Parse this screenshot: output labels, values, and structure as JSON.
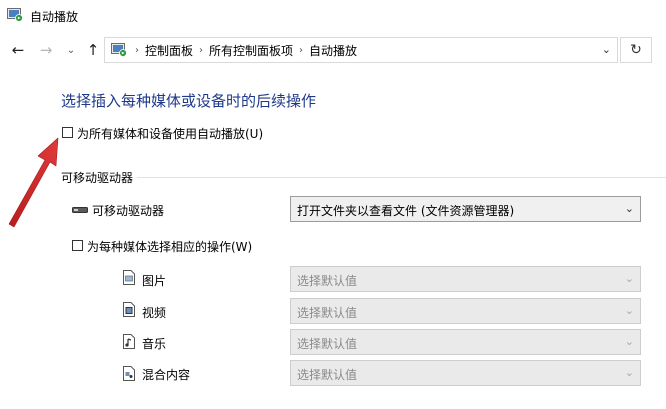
{
  "window": {
    "title": "自动播放"
  },
  "nav": {
    "back_icon": "back-arrow-icon",
    "forward_icon": "forward-arrow-icon",
    "recent_icon": "chevron-down-icon",
    "up_icon": "up-arrow-icon",
    "breadcrumb": [
      "控制面板",
      "所有控制面板项",
      "自动播放"
    ],
    "refresh_icon": "refresh-icon"
  },
  "main": {
    "heading": "选择插入每种媒体或设备时的后续操作",
    "use_autoplay_all": {
      "label": "为所有媒体和设备使用自动播放(U)",
      "checked": false
    },
    "removable_section": {
      "title": "可移动驱动器",
      "drive": {
        "label": "可移动驱动器",
        "value": "打开文件夹以查看文件 (文件资源管理器)"
      },
      "choose_each": {
        "label": "为每种媒体选择相应的操作(W)",
        "checked": false
      },
      "media": [
        {
          "label": "图片",
          "value": "选择默认值",
          "icon": "picture-file-icon"
        },
        {
          "label": "视频",
          "value": "选择默认值",
          "icon": "video-file-icon"
        },
        {
          "label": "音乐",
          "value": "选择默认值",
          "icon": "music-file-icon"
        },
        {
          "label": "混合内容",
          "value": "选择默认值",
          "icon": "mixed-content-file-icon"
        }
      ]
    }
  },
  "colors": {
    "heading": "#1e3a8a",
    "annotation_arrow": "#d32a2a"
  }
}
